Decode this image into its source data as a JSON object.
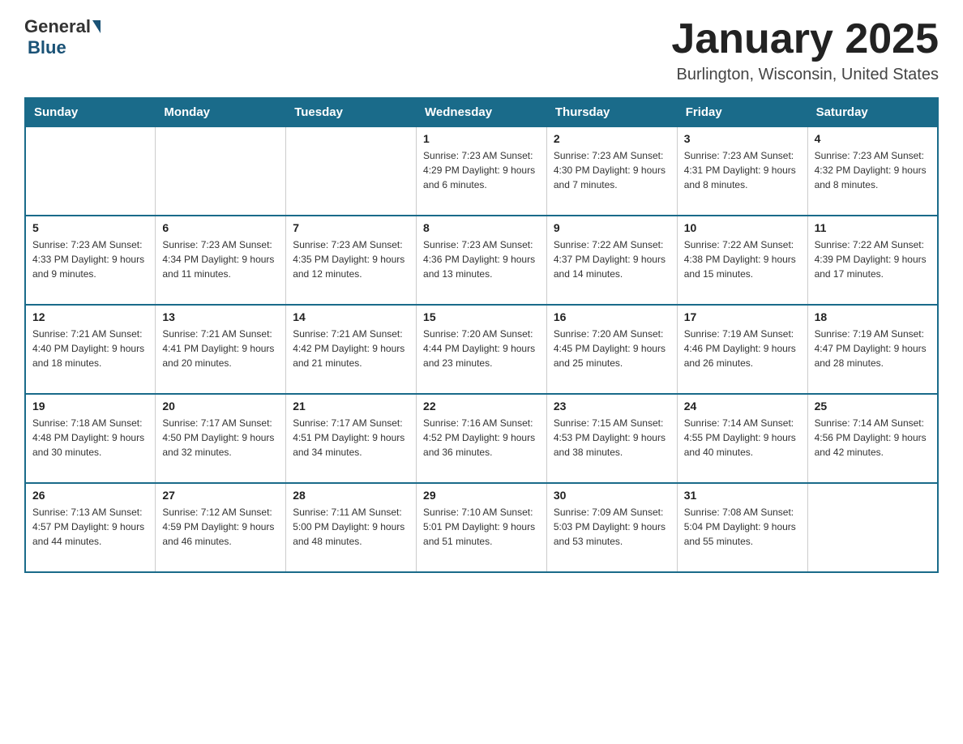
{
  "header": {
    "logo_general": "General",
    "logo_blue": "Blue",
    "month_title": "January 2025",
    "location": "Burlington, Wisconsin, United States"
  },
  "days_of_week": [
    "Sunday",
    "Monday",
    "Tuesday",
    "Wednesday",
    "Thursday",
    "Friday",
    "Saturday"
  ],
  "weeks": [
    [
      {
        "day": "",
        "info": ""
      },
      {
        "day": "",
        "info": ""
      },
      {
        "day": "",
        "info": ""
      },
      {
        "day": "1",
        "info": "Sunrise: 7:23 AM\nSunset: 4:29 PM\nDaylight: 9 hours and 6 minutes."
      },
      {
        "day": "2",
        "info": "Sunrise: 7:23 AM\nSunset: 4:30 PM\nDaylight: 9 hours and 7 minutes."
      },
      {
        "day": "3",
        "info": "Sunrise: 7:23 AM\nSunset: 4:31 PM\nDaylight: 9 hours and 8 minutes."
      },
      {
        "day": "4",
        "info": "Sunrise: 7:23 AM\nSunset: 4:32 PM\nDaylight: 9 hours and 8 minutes."
      }
    ],
    [
      {
        "day": "5",
        "info": "Sunrise: 7:23 AM\nSunset: 4:33 PM\nDaylight: 9 hours and 9 minutes."
      },
      {
        "day": "6",
        "info": "Sunrise: 7:23 AM\nSunset: 4:34 PM\nDaylight: 9 hours and 11 minutes."
      },
      {
        "day": "7",
        "info": "Sunrise: 7:23 AM\nSunset: 4:35 PM\nDaylight: 9 hours and 12 minutes."
      },
      {
        "day": "8",
        "info": "Sunrise: 7:23 AM\nSunset: 4:36 PM\nDaylight: 9 hours and 13 minutes."
      },
      {
        "day": "9",
        "info": "Sunrise: 7:22 AM\nSunset: 4:37 PM\nDaylight: 9 hours and 14 minutes."
      },
      {
        "day": "10",
        "info": "Sunrise: 7:22 AM\nSunset: 4:38 PM\nDaylight: 9 hours and 15 minutes."
      },
      {
        "day": "11",
        "info": "Sunrise: 7:22 AM\nSunset: 4:39 PM\nDaylight: 9 hours and 17 minutes."
      }
    ],
    [
      {
        "day": "12",
        "info": "Sunrise: 7:21 AM\nSunset: 4:40 PM\nDaylight: 9 hours and 18 minutes."
      },
      {
        "day": "13",
        "info": "Sunrise: 7:21 AM\nSunset: 4:41 PM\nDaylight: 9 hours and 20 minutes."
      },
      {
        "day": "14",
        "info": "Sunrise: 7:21 AM\nSunset: 4:42 PM\nDaylight: 9 hours and 21 minutes."
      },
      {
        "day": "15",
        "info": "Sunrise: 7:20 AM\nSunset: 4:44 PM\nDaylight: 9 hours and 23 minutes."
      },
      {
        "day": "16",
        "info": "Sunrise: 7:20 AM\nSunset: 4:45 PM\nDaylight: 9 hours and 25 minutes."
      },
      {
        "day": "17",
        "info": "Sunrise: 7:19 AM\nSunset: 4:46 PM\nDaylight: 9 hours and 26 minutes."
      },
      {
        "day": "18",
        "info": "Sunrise: 7:19 AM\nSunset: 4:47 PM\nDaylight: 9 hours and 28 minutes."
      }
    ],
    [
      {
        "day": "19",
        "info": "Sunrise: 7:18 AM\nSunset: 4:48 PM\nDaylight: 9 hours and 30 minutes."
      },
      {
        "day": "20",
        "info": "Sunrise: 7:17 AM\nSunset: 4:50 PM\nDaylight: 9 hours and 32 minutes."
      },
      {
        "day": "21",
        "info": "Sunrise: 7:17 AM\nSunset: 4:51 PM\nDaylight: 9 hours and 34 minutes."
      },
      {
        "day": "22",
        "info": "Sunrise: 7:16 AM\nSunset: 4:52 PM\nDaylight: 9 hours and 36 minutes."
      },
      {
        "day": "23",
        "info": "Sunrise: 7:15 AM\nSunset: 4:53 PM\nDaylight: 9 hours and 38 minutes."
      },
      {
        "day": "24",
        "info": "Sunrise: 7:14 AM\nSunset: 4:55 PM\nDaylight: 9 hours and 40 minutes."
      },
      {
        "day": "25",
        "info": "Sunrise: 7:14 AM\nSunset: 4:56 PM\nDaylight: 9 hours and 42 minutes."
      }
    ],
    [
      {
        "day": "26",
        "info": "Sunrise: 7:13 AM\nSunset: 4:57 PM\nDaylight: 9 hours and 44 minutes."
      },
      {
        "day": "27",
        "info": "Sunrise: 7:12 AM\nSunset: 4:59 PM\nDaylight: 9 hours and 46 minutes."
      },
      {
        "day": "28",
        "info": "Sunrise: 7:11 AM\nSunset: 5:00 PM\nDaylight: 9 hours and 48 minutes."
      },
      {
        "day": "29",
        "info": "Sunrise: 7:10 AM\nSunset: 5:01 PM\nDaylight: 9 hours and 51 minutes."
      },
      {
        "day": "30",
        "info": "Sunrise: 7:09 AM\nSunset: 5:03 PM\nDaylight: 9 hours and 53 minutes."
      },
      {
        "day": "31",
        "info": "Sunrise: 7:08 AM\nSunset: 5:04 PM\nDaylight: 9 hours and 55 minutes."
      },
      {
        "day": "",
        "info": ""
      }
    ]
  ]
}
